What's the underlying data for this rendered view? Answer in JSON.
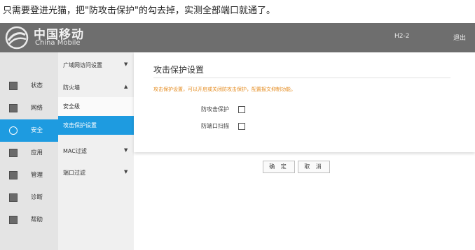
{
  "caption": "只需要登进光猫，把\"防攻击保护\"的勾去掉，实测全部端口就通了。",
  "header": {
    "brand_cn": "中国移动",
    "brand_en": "China Mobile",
    "model": "H2-2",
    "logout": "退出"
  },
  "left_nav": [
    {
      "label": "状态",
      "icon": "status-icon"
    },
    {
      "label": "网络",
      "icon": "network-icon"
    },
    {
      "label": "安全",
      "icon": "security-icon",
      "active": true
    },
    {
      "label": "应用",
      "icon": "apps-icon"
    },
    {
      "label": "管理",
      "icon": "manage-icon"
    },
    {
      "label": "诊断",
      "icon": "diagnose-icon"
    },
    {
      "label": "帮助",
      "icon": "help-icon"
    }
  ],
  "sub_menu": [
    {
      "label": "广域网访问设置",
      "arrow": "▼"
    },
    {
      "label": "防火墙",
      "arrow": "▲"
    },
    {
      "label": "安全级",
      "arrow": ""
    },
    {
      "label": "攻击保护设置",
      "arrow": "",
      "active": true
    },
    {
      "label": "MAC过滤",
      "arrow": "▼"
    },
    {
      "label": "端口过滤",
      "arrow": "▼"
    }
  ],
  "main": {
    "title": "攻击保护设置",
    "description": "攻击保护设置，可以开启或关闭防攻击保护，配置报文抑制功能。",
    "options": [
      {
        "label": "防攻击保护",
        "checked": false
      },
      {
        "label": "防端口扫描",
        "checked": false
      }
    ],
    "confirm_label": "确 定",
    "cancel_label": "取 消"
  },
  "colors": {
    "accent": "#1e9be0",
    "header_bg": "#6e6e6e",
    "warning_text": "#e48a1c"
  }
}
